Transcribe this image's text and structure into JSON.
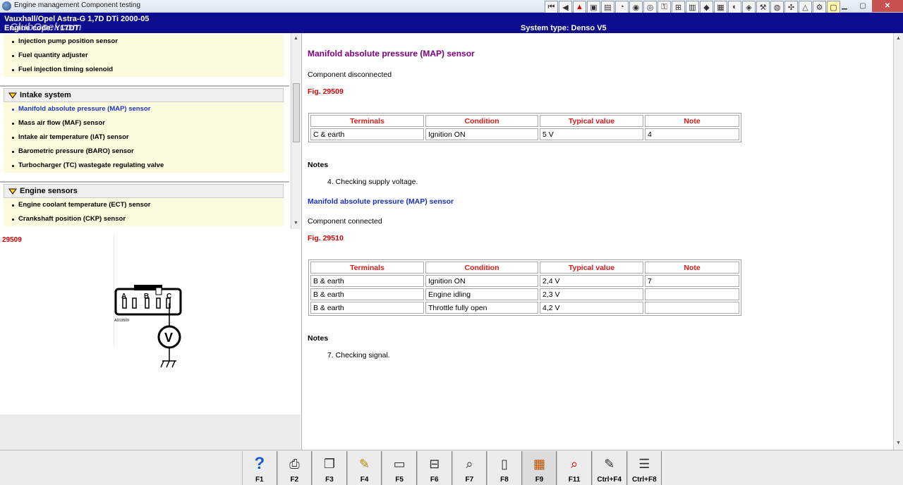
{
  "window": {
    "title": "Engine management Component testing",
    "controls": [
      "minimize",
      "maximize",
      "close"
    ]
  },
  "toolbar": {
    "icons": [
      "first-icon",
      "previous-icon",
      "warning-icon",
      "engine-icon",
      "chart-icon",
      "gauge-icon",
      "lamp-icon",
      "dial-icon",
      "key-icon",
      "connector-icon",
      "tank-icon",
      "oil-icon",
      "battery-icon",
      "car-icon",
      "pump-icon",
      "wrench-icon",
      "brake-icon",
      "fan-icon",
      "alert-icon",
      "settings-icon",
      "window-icon"
    ]
  },
  "vehicle": {
    "line1": "Vauxhall/Opel   Astra-G  1,7D DTi 2000-05",
    "line2": "Engine code: Y17DT",
    "watermark": "ClubOpel.com",
    "system": "System type: Denso V5"
  },
  "nav": {
    "fuel_items": [
      {
        "label": "Injection pump position sensor"
      },
      {
        "label": "Fuel quantity adjuster"
      },
      {
        "label": "Fuel injection timing solenoid"
      }
    ],
    "intake": {
      "header": "Intake system",
      "items": [
        {
          "label": "Manifold absolute pressure (MAP) sensor"
        },
        {
          "label": "Mass air flow (MAF) sensor"
        },
        {
          "label": "Intake air temperature (IAT) sensor"
        },
        {
          "label": "Barometric pressure (BARO) sensor"
        },
        {
          "label": "Turbocharger (TC) wastegate regulating valve"
        }
      ]
    },
    "engine_sensors": {
      "header": "Engine sensors",
      "items": [
        {
          "label": "Engine coolant temperature (ECT) sensor"
        },
        {
          "label": "Crankshaft position (CKP) sensor"
        }
      ]
    }
  },
  "diagram": {
    "fig_number": "29509",
    "pins": [
      "A",
      "B",
      "C"
    ],
    "meter": "V",
    "code": "AD19509"
  },
  "content": {
    "title": "Manifold absolute pressure (MAP) sensor",
    "section1": {
      "state": "Component disconnected",
      "fig": "Fig. 29509",
      "headers": [
        "Terminals",
        "Condition",
        "Typical value",
        "Note"
      ],
      "rows": [
        [
          "C & earth",
          "Ignition ON",
          "5 V",
          "4"
        ]
      ],
      "notes_label": "Notes",
      "note": "4. Checking supply voltage."
    },
    "section2": {
      "title": "Manifold absolute pressure (MAP) sensor",
      "state": "Component connected",
      "fig": "Fig. 29510",
      "headers": [
        "Terminals",
        "Condition",
        "Typical value",
        "Note"
      ],
      "rows": [
        [
          "B & earth",
          "Ignition ON",
          "2,4 V",
          "7"
        ],
        [
          "B & earth",
          "Engine idling",
          "2,3 V",
          ""
        ],
        [
          "B & earth",
          "Throttle fully open",
          "4,2 V",
          ""
        ]
      ],
      "notes_label": "Notes",
      "note": "7. Checking signal."
    }
  },
  "fkeys": [
    {
      "label": "F1",
      "icon": "help-icon"
    },
    {
      "label": "F2",
      "icon": "print-icon"
    },
    {
      "label": "F3",
      "icon": "copy-icon"
    },
    {
      "label": "F4",
      "icon": "notes-icon"
    },
    {
      "label": "F5",
      "icon": "component-icon"
    },
    {
      "label": "F6",
      "icon": "pinout-icon"
    },
    {
      "label": "F7",
      "icon": "zoom-icon"
    },
    {
      "label": "F8",
      "icon": "book-icon"
    },
    {
      "label": "F9",
      "icon": "images-icon"
    },
    {
      "label": "F11",
      "icon": "search-icon"
    },
    {
      "label": "Ctrl+F4",
      "icon": "edit-list-icon"
    },
    {
      "label": "Ctrl+F8",
      "icon": "list-icon"
    }
  ]
}
